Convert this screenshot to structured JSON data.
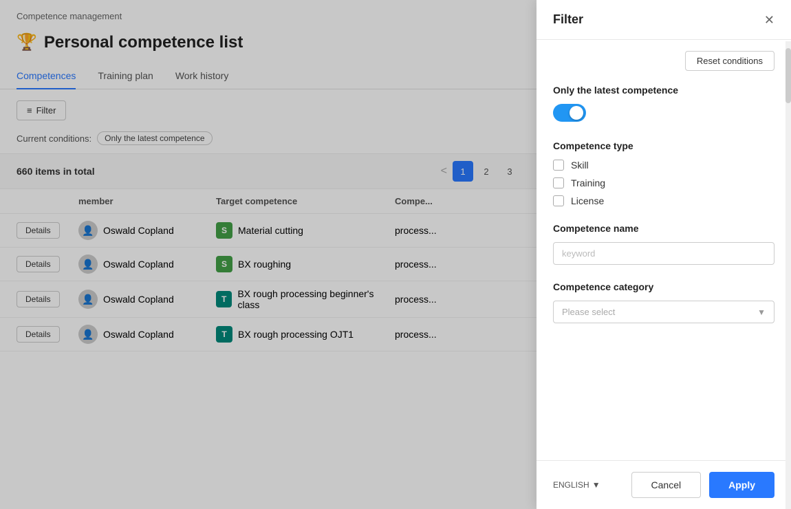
{
  "breadcrumb": "Competence management",
  "page": {
    "icon": "🏆",
    "title": "Personal competence list"
  },
  "tabs": [
    {
      "id": "competences",
      "label": "Competences",
      "active": true
    },
    {
      "id": "training-plan",
      "label": "Training plan",
      "active": false
    },
    {
      "id": "work-history",
      "label": "Work history",
      "active": false
    }
  ],
  "toolbar": {
    "filter_label": "Filter"
  },
  "current_conditions": {
    "label": "Current conditions:",
    "tags": [
      "Only the latest competence"
    ]
  },
  "table": {
    "total_items": "660 items in total",
    "pagination": {
      "prev": "<",
      "pages": [
        "1",
        "2",
        "3"
      ],
      "active_page": "1"
    },
    "columns": [
      "member",
      "Target competence",
      "Compe..."
    ],
    "rows": [
      {
        "btn": "Details",
        "member_name": "Oswald Copland",
        "competence_icon": "S",
        "competence_icon_color": "green",
        "competence_name": "Material cutting",
        "type": "process..."
      },
      {
        "btn": "Details",
        "member_name": "Oswald Copland",
        "competence_icon": "S",
        "competence_icon_color": "green",
        "competence_name": "BX roughing",
        "type": "process..."
      },
      {
        "btn": "Details",
        "member_name": "Oswald Copland",
        "competence_icon": "T",
        "competence_icon_color": "teal",
        "competence_name": "BX rough processing beginner's class",
        "type": "process..."
      },
      {
        "btn": "Details",
        "member_name": "Oswald Copland",
        "competence_icon": "T",
        "competence_icon_color": "teal",
        "competence_name": "BX rough processing OJT1",
        "type": "process..."
      }
    ]
  },
  "filter_panel": {
    "title": "Filter",
    "reset_btn": "Reset conditions",
    "sections": {
      "latest_competence": {
        "label": "Only the latest competence",
        "toggle_on": true
      },
      "competence_type": {
        "label": "Competence type",
        "options": [
          {
            "id": "skill",
            "label": "Skill",
            "checked": false
          },
          {
            "id": "training",
            "label": "Training",
            "checked": false
          },
          {
            "id": "license",
            "label": "License",
            "checked": false
          }
        ]
      },
      "competence_name": {
        "label": "Competence name",
        "placeholder": "keyword"
      },
      "competence_category": {
        "label": "Competence category",
        "placeholder": "Please select"
      }
    },
    "footer": {
      "cancel_label": "Cancel",
      "apply_label": "Apply",
      "language": "ENGLISH"
    }
  }
}
